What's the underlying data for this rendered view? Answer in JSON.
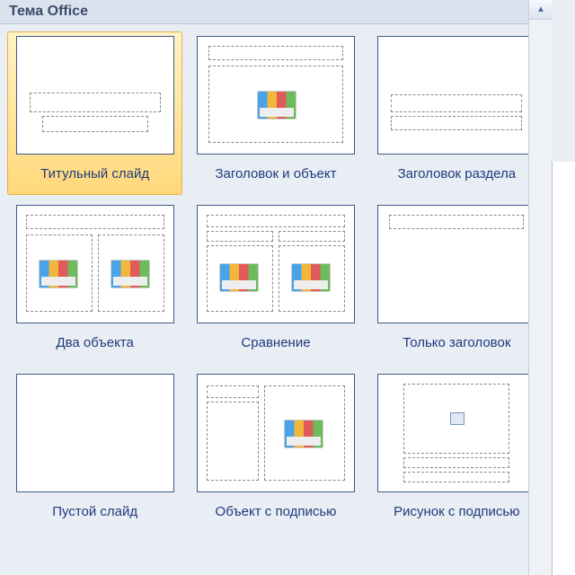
{
  "header": {
    "title": "Тема Office"
  },
  "layouts": [
    {
      "label": "Титульный слайд",
      "selected": true
    },
    {
      "label": "Заголовок и объект",
      "selected": false
    },
    {
      "label": "Заголовок раздела",
      "selected": false
    },
    {
      "label": "Два объекта",
      "selected": false
    },
    {
      "label": "Сравнение",
      "selected": false
    },
    {
      "label": "Только заголовок",
      "selected": false
    },
    {
      "label": "Пустой слайд",
      "selected": false
    },
    {
      "label": "Объект с подписью",
      "selected": false
    },
    {
      "label": "Рисунок с подписью",
      "selected": false
    }
  ]
}
